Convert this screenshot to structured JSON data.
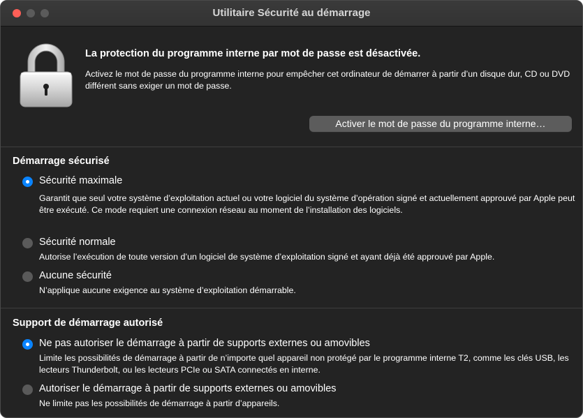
{
  "window": {
    "title": "Utilitaire Sécurité au démarrage"
  },
  "firmware": {
    "status_title": "La protection du programme interne par mot de passe est désactivée.",
    "description": "Activez le mot de passe du programme interne pour empêcher cet ordinateur de démarrer à partir d’un disque dur, CD ou DVD différent sans exiger un mot de passe.",
    "button_label": "Activer le mot de passe du programme interne…"
  },
  "secure_boot": {
    "title": "Démarrage sécurisé",
    "options": [
      {
        "label": "Sécurité maximale",
        "selected": true,
        "description": "Garantit que seul votre système d’exploitation actuel ou votre logiciel du système d’opération signé et actuellement approuvé par Apple peut être exécuté. Ce mode requiert une connexion réseau au moment de l’installation des logiciels."
      },
      {
        "label": "Sécurité normale",
        "selected": false,
        "description": "Autorise l’exécution de toute version d’un logiciel de système d’exploitation signé et ayant déjà été approuvé par Apple."
      },
      {
        "label": "Aucune sécurité",
        "selected": false,
        "description": "N’applique aucune exigence au système d’exploitation démarrable."
      }
    ]
  },
  "boot_media": {
    "title": "Support de démarrage autorisé",
    "options": [
      {
        "label": "Ne pas autoriser le démarrage à partir de supports externes ou amovibles",
        "selected": true,
        "description": "Limite les possibilités de démarrage à partir de n’importe quel appareil non protégé par le programme interne T2, comme les clés USB, les lecteurs Thunderbolt, ou les lecteurs PCIe ou SATA connectés en interne."
      },
      {
        "label": "Autoriser le démarrage à partir de supports externes ou amovibles",
        "selected": false,
        "description": "Ne limite pas les possibilités de démarrage à partir d’appareils."
      }
    ]
  },
  "colors": {
    "accent": "#0a84ff",
    "window_bg": "#232323",
    "close_button": "#ff5f57"
  },
  "icons": {
    "lock": "padlock-icon"
  }
}
